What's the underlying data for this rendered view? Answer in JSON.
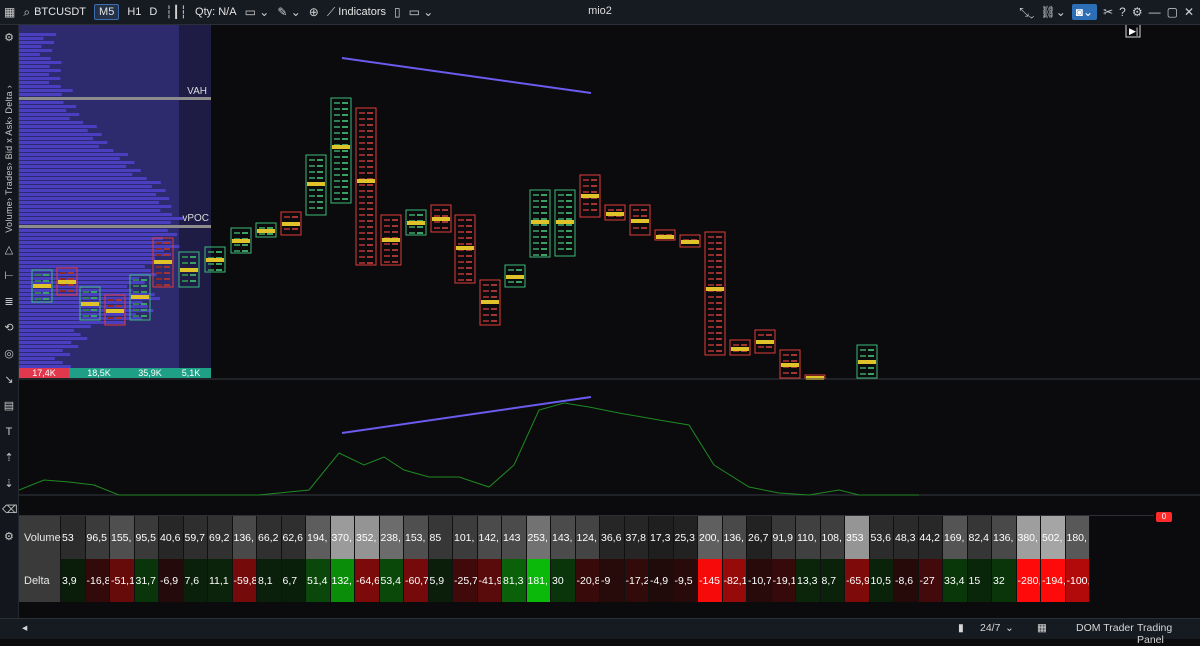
{
  "toolbar": {
    "symbol": "BTCUSDT",
    "timeframes": [
      "M5",
      "H1",
      "D"
    ],
    "qty": "Qty: N/A",
    "indicators": "Indicators",
    "window_title": "mio2"
  },
  "sidebar": {
    "vertical_label": "Volume› Trades› Bid x Ask› Delta ›"
  },
  "profile": {
    "vah": "VAH",
    "vpoc": "vPOC",
    "stats": [
      "17,4K",
      "18,5K",
      "35,9K",
      "5,1K"
    ],
    "stat_colors": [
      "#e0384c",
      "#1e9f86",
      "#1e9f86",
      "#1e9f86"
    ]
  },
  "grid": {
    "volume_label": "Volume",
    "delta_label": "Delta",
    "volume": [
      "53",
      "96,5",
      "155,",
      "95,5",
      "40,6",
      "59,7",
      "69,2",
      "136,",
      "66,2",
      "62,6",
      "194,",
      "370,",
      "352,",
      "238,",
      "153,",
      "85",
      "101,",
      "142,",
      "143",
      "253,",
      "143,",
      "124,",
      "36,6",
      "37,8",
      "17,3",
      "25,3",
      "200,",
      "136,",
      "26,7",
      "91,9",
      "110,",
      "108,",
      "353",
      "53,6",
      "48,3",
      "44,2",
      "169,",
      "82,4",
      "136,",
      "380,",
      "502,",
      "180,"
    ],
    "delta": [
      "3,9",
      "-16,8",
      "-51,1",
      "31,7",
      "-6,9",
      "7,6",
      "11,1",
      "-59,8",
      "8,1",
      "6,7",
      "51,4",
      "132,",
      "-64,6",
      "53,4",
      "-60,7",
      "5,9",
      "-25,7",
      "-41,9",
      "81,3",
      "181,",
      "30",
      "-20,8",
      "-9",
      "-17,2",
      "-4,9",
      "-9,5",
      "-145",
      "-82,1",
      "-10,7",
      "-19,1",
      "13,3",
      "8,7",
      "-65,9",
      "10,5",
      "-8,6",
      "-27",
      "33,4",
      "15",
      "32",
      "-280,",
      "-194,",
      "-100,"
    ],
    "badge": "0"
  },
  "bottom": {
    "session": "24/7",
    "dom": "DOM Trader",
    "trading": "Trading Panel"
  },
  "colors": {
    "bull": "#3cb87a",
    "bear": "#e23b3b",
    "profile": "#3a2f8a",
    "trendline": "#6b5cf0",
    "delta_line": "#1f8a22"
  }
}
